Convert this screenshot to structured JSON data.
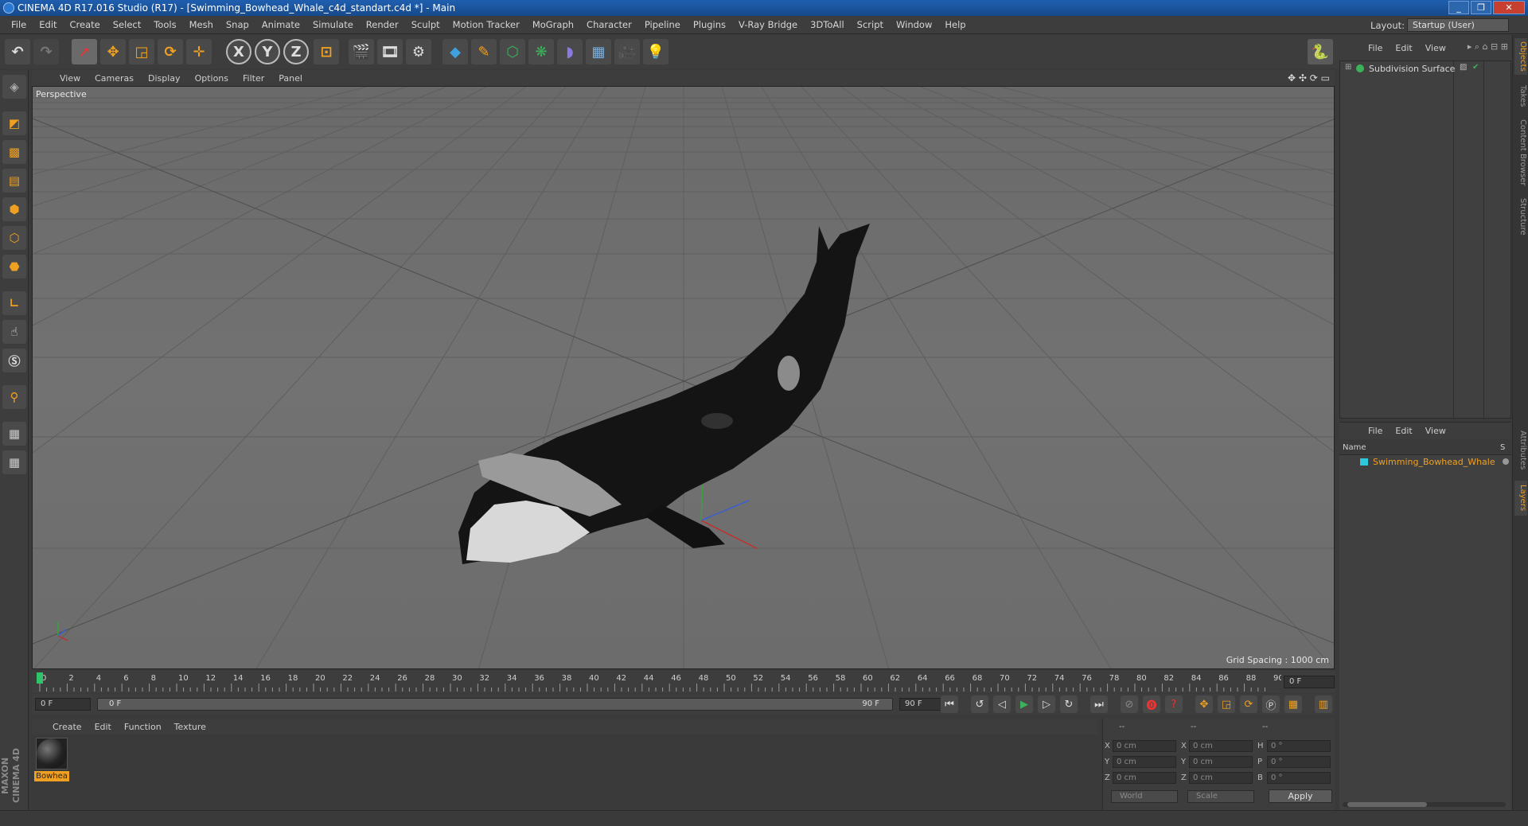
{
  "window": {
    "title": "CINEMA 4D R17.016 Studio (R17) - [Swimming_Bowhead_Whale_c4d_standart.c4d *] - Main",
    "controls": [
      "_",
      "❐",
      "✕"
    ]
  },
  "menu": [
    "File",
    "Edit",
    "Create",
    "Select",
    "Tools",
    "Mesh",
    "Snap",
    "Animate",
    "Simulate",
    "Render",
    "Sculpt",
    "Motion Tracker",
    "MoGraph",
    "Character",
    "Pipeline",
    "Plugins",
    "V-Ray Bridge",
    "3DToAll",
    "Script",
    "Window",
    "Help"
  ],
  "layout": {
    "label": "Layout:",
    "value": "Startup (User)"
  },
  "toolbar": {
    "icons": [
      "undo-icon",
      "redo-icon",
      "live-selection-icon",
      "move-icon",
      "scale-icon",
      "rotate-icon",
      "recent-tools-icon",
      "x-axis-icon",
      "y-axis-icon",
      "z-axis-icon",
      "world-coordinates-icon",
      "render-view-icon",
      "render-picture-viewer-icon",
      "edit-render-settings-icon",
      "cube-icon",
      "pen-icon",
      "subdivision-icon",
      "cloner-icon",
      "deformer-icon",
      "floor-icon",
      "camera-icon",
      "light-icon",
      "python-icon"
    ],
    "axis_labels": [
      "X",
      "Y",
      "Z"
    ]
  },
  "viewport": {
    "menu": [
      "View",
      "Cameras",
      "Display",
      "Options",
      "Filter",
      "Panel"
    ],
    "camera": "Perspective",
    "grid_spacing": "Grid Spacing : 1000 cm"
  },
  "timeline": {
    "ticks": [
      "0",
      "2",
      "4",
      "6",
      "8",
      "10",
      "12",
      "14",
      "16",
      "18",
      "20",
      "22",
      "24",
      "26",
      "28",
      "30",
      "32",
      "34",
      "36",
      "38",
      "40",
      "42",
      "44",
      "46",
      "48",
      "50",
      "52",
      "54",
      "56",
      "58",
      "60",
      "62",
      "64",
      "66",
      "68",
      "70",
      "72",
      "74",
      "76",
      "78",
      "80",
      "82",
      "84",
      "86",
      "88",
      "90"
    ],
    "current_frame": "0 F",
    "start_field": "0 F",
    "range_start": "0 F",
    "range_end": "90 F",
    "end_field": "90 F"
  },
  "material_manager": {
    "menu": [
      "Create",
      "Edit",
      "Function",
      "Texture"
    ],
    "material_name": "Bowhea"
  },
  "coordinates": {
    "headers": [
      "--",
      "--",
      "--"
    ],
    "rows": [
      {
        "axis": "X",
        "pos": "0 cm",
        "size_axis": "X",
        "size": "0 cm",
        "rot_axis": "H",
        "rot": "0 °"
      },
      {
        "axis": "Y",
        "pos": "0 cm",
        "size_axis": "Y",
        "size": "0 cm",
        "rot_axis": "P",
        "rot": "0 °"
      },
      {
        "axis": "Z",
        "pos": "0 cm",
        "size_axis": "Z",
        "size": "0 cm",
        "rot_axis": "B",
        "rot": "0 °"
      }
    ],
    "mode": "World",
    "scale_mode": "Scale",
    "apply": "Apply"
  },
  "objects_panel": {
    "menu": [
      "File",
      "Edit",
      "View"
    ],
    "items": [
      {
        "name": "Subdivision Surface"
      }
    ]
  },
  "layers_panel": {
    "menu": [
      "File",
      "Edit",
      "View"
    ],
    "header_name": "Name",
    "header_s": "S",
    "items": [
      {
        "name": "Swimming_Bowhead_Whale"
      }
    ]
  },
  "side_tabs": [
    "Objects",
    "Takes",
    "Content Browser",
    "Structure",
    "Attributes",
    "Layers"
  ],
  "brand": "MAXON CINEMA 4D"
}
